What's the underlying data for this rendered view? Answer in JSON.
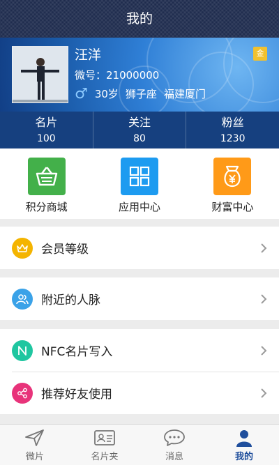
{
  "header": {
    "title": "我的"
  },
  "profile": {
    "name": "汪洋",
    "wechat": "微号：21000000",
    "age": "30岁",
    "zodiac": "狮子座",
    "location": "福建厦门",
    "badge": "金",
    "gender_icon": "male-icon"
  },
  "stats": [
    {
      "label": "名片",
      "value": "100"
    },
    {
      "label": "关注",
      "value": "80"
    },
    {
      "label": "粉丝",
      "value": "1230"
    }
  ],
  "apps": [
    {
      "label": "积分商城",
      "color": "#43b04a",
      "icon": "basket-icon"
    },
    {
      "label": "应用中心",
      "color": "#1d9bf0",
      "icon": "grid-icon"
    },
    {
      "label": "财富中心",
      "color": "#ff9a18",
      "icon": "money-bag-icon"
    }
  ],
  "menu": {
    "member": {
      "label": "会员等级",
      "color": "#f4b400",
      "icon": "crown-icon"
    },
    "nearby": {
      "label": "附近的人脉",
      "color": "#3aa2e8",
      "icon": "people-icon"
    },
    "nfc": {
      "label": "NFC名片写入",
      "color": "#1fc6a0",
      "icon": "nfc-icon"
    },
    "recommend": {
      "label": "推荐好友使用",
      "color": "#e8337a",
      "icon": "share-icon"
    }
  },
  "tabs": [
    {
      "label": "微片",
      "icon": "paper-plane-icon",
      "active": false
    },
    {
      "label": "名片夹",
      "icon": "card-holder-icon",
      "active": false
    },
    {
      "label": "消息",
      "icon": "chat-bubble-icon",
      "active": false
    },
    {
      "label": "我的",
      "icon": "user-icon",
      "active": true
    }
  ],
  "colors": {
    "titlebar": "#1f2c4e",
    "stats_bar": "#16407f",
    "active_tab": "#1f4e9c"
  }
}
